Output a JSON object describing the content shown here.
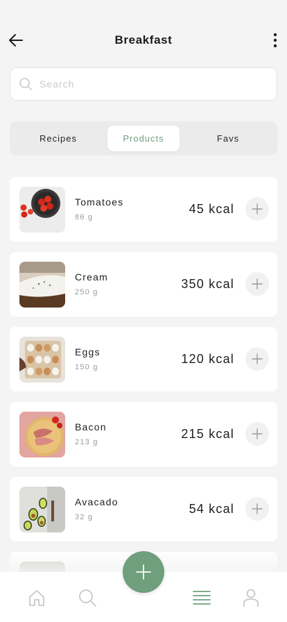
{
  "header": {
    "title": "Breakfast"
  },
  "search": {
    "placeholder": "Search",
    "value": ""
  },
  "tabs": [
    {
      "label": "Recipes",
      "active": false
    },
    {
      "label": "Products",
      "active": true
    },
    {
      "label": "Favs",
      "active": false
    }
  ],
  "products": [
    {
      "name": "Tomatoes",
      "weight": "86 g",
      "kcal": "45 kcal"
    },
    {
      "name": "Cream",
      "weight": "250 g",
      "kcal": "350 kcal"
    },
    {
      "name": "Eggs",
      "weight": "150 g",
      "kcal": "120 kcal"
    },
    {
      "name": "Bacon",
      "weight": "213 g",
      "kcal": "215 kcal"
    },
    {
      "name": "Avacado",
      "weight": "32 g",
      "kcal": "54 kcal"
    }
  ],
  "bottom_nav": [
    "home-icon",
    "search-icon",
    "list-icon",
    "profile-icon"
  ],
  "colors": {
    "accent": "#6f9f7c",
    "background": "#f4f4f4",
    "card": "#ffffff"
  }
}
